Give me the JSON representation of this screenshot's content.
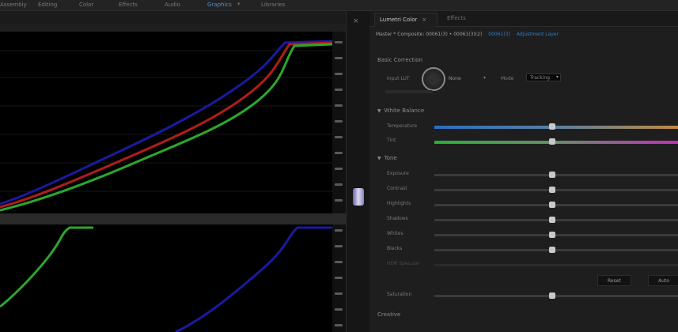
{
  "workspace_tabs": [
    {
      "label": "Assembly",
      "active": false
    },
    {
      "label": "Editing",
      "active": false
    },
    {
      "label": "Color",
      "active": false
    },
    {
      "label": "Effects",
      "active": false
    },
    {
      "label": "Audio",
      "active": true
    },
    {
      "label": "Graphics",
      "active": false
    },
    {
      "label": "Libraries",
      "active": false
    }
  ],
  "lumetri": {
    "tabs": {
      "active": "Lumetri Color",
      "close_glyph": "×",
      "second": "Effects"
    },
    "clip": {
      "master": "Master * Composite: 00061(3) • 00061(3)(2)",
      "links": [
        "00061(3)",
        "Adjustment Layer"
      ]
    },
    "basic_correction": {
      "heading": "Basic Correction",
      "input_lut_label": "Input LUT",
      "input_lut_value": "None",
      "mode_label": "Mode",
      "mode_value": "Tracking"
    },
    "white_balance": {
      "heading": "White Balance",
      "temperature": "Temperature",
      "tint": "Tint"
    },
    "tone": {
      "heading": "Tone",
      "rows": [
        "Exposure",
        "Contrast",
        "Highlights",
        "Shadows",
        "Whites",
        "Blacks",
        "HDR Specular"
      ]
    },
    "buttons": {
      "reset": "Reset",
      "auto": "Auto"
    },
    "saturation": "Saturation",
    "creative": "Creative"
  },
  "colors": {
    "accent": "#4a8fd0",
    "curve_red": "#b01c1c",
    "curve_green": "#2ba82b",
    "curve_blue": "#1a1aa0"
  },
  "icons": {
    "panel_close": "×",
    "disclosure": "▼",
    "dropdown": "▾"
  }
}
